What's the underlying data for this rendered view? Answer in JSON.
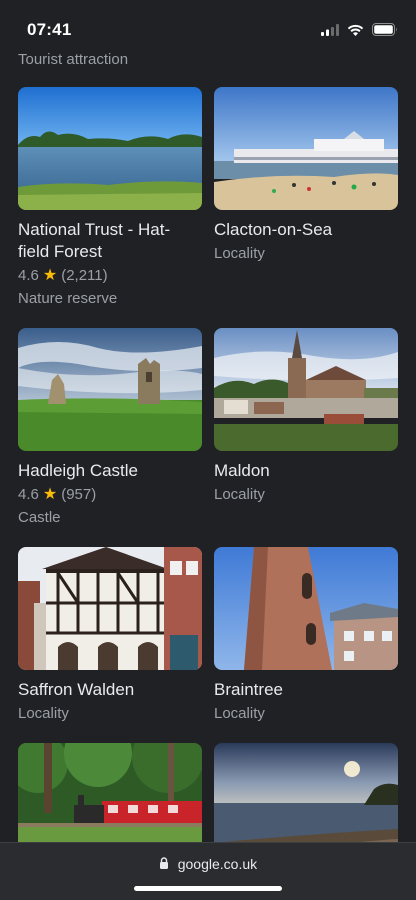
{
  "status_bar": {
    "time": "07:41"
  },
  "prev_card_subtitle": "Tourist attraction",
  "places": [
    {
      "title": "National Trust - Hatfield Forest",
      "title_line1": "National Trust - Hat-",
      "title_line2": "field Forest",
      "rating": "4.6",
      "reviews": "(2,211)",
      "type": "Nature reserve"
    },
    {
      "title": "Clacton-on-Sea",
      "type": "Locality"
    },
    {
      "title": "Hadleigh Castle",
      "rating": "4.6",
      "reviews": "(957)",
      "type": "Castle"
    },
    {
      "title": "Maldon",
      "type": "Locality"
    },
    {
      "title": "Saffron Walden",
      "type": "Locality"
    },
    {
      "title": "Braintree",
      "type": "Locality"
    }
  ],
  "browser": {
    "url": "google.co.uk"
  },
  "colors": {
    "star": "#fbbc04",
    "background": "#202124",
    "muted_text": "#9aa0a6"
  }
}
